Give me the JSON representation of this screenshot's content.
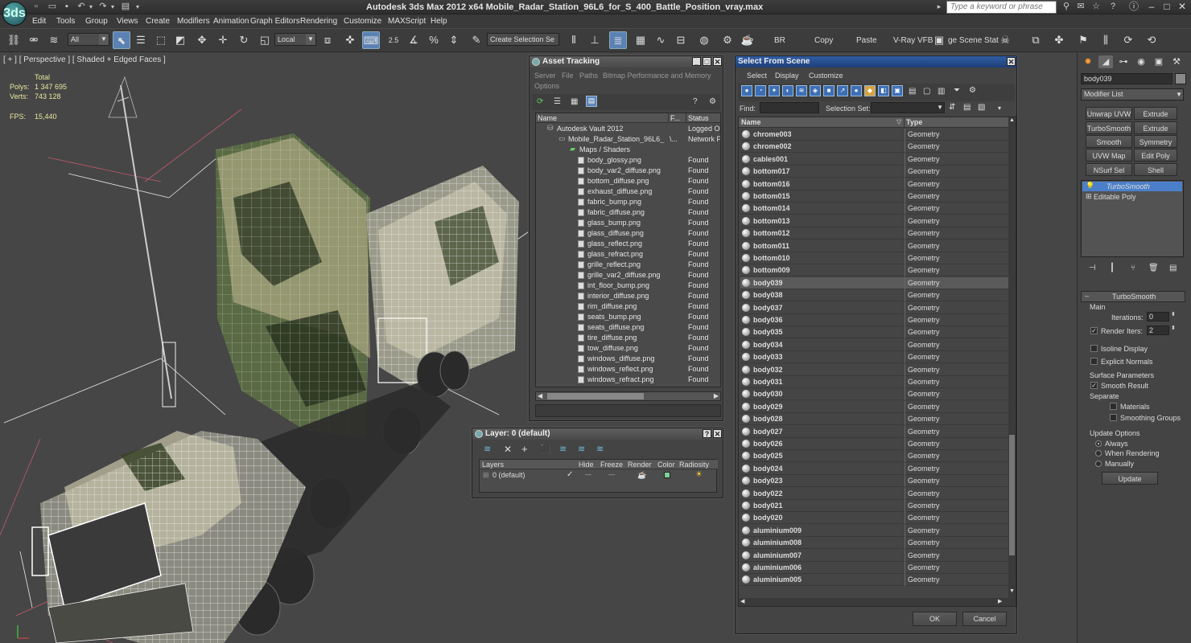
{
  "app": {
    "logo": "3ds",
    "title": "Autodesk 3ds Max  2012 x64      Mobile_Radar_Station_96L6_for_S_400_Battle_Position_vray.max",
    "search_placeholder": "Type a keyword or phrase",
    "quick_access_icons": [
      "new-file-icon",
      "open-file-icon",
      "save-icon",
      "undo-icon",
      "undo-dropdown-icon",
      "redo-icon",
      "redo-dropdown-icon",
      "project-folder-icon",
      "quick-access-dropdown-icon"
    ],
    "title_right_icons": [
      "binoculars-icon",
      "favorites-icon",
      "star-icon",
      "help-icon"
    ]
  },
  "menu": [
    "Edit",
    "Tools",
    "Group",
    "Views",
    "Create",
    "Modifiers",
    "Animation",
    "Graph Editors",
    "Rendering",
    "Customize",
    "MAXScript",
    "Help"
  ],
  "toolbar": {
    "selection_filter": "All",
    "reference_coord": "Local",
    "named_selection": "Create Selection Se",
    "snap_labels": [
      "2.5",
      "%"
    ],
    "text_buttons": [
      "BR",
      "Copy",
      "Paste",
      "V-Ray VFB",
      "ge Scene Stat"
    ]
  },
  "viewport": {
    "label": "[ + ] [ Perspective ] [ Shaded + Edged Faces ]",
    "stats": {
      "header": "Total",
      "polys_label": "Polys:",
      "polys_value": "1 347 695",
      "verts_label": "Verts:",
      "verts_value": "743 128",
      "fps_label": "FPS:",
      "fps_value": "15,440"
    }
  },
  "asset_tracking": {
    "title": "Asset Tracking",
    "menu": [
      "Server",
      "File",
      "Paths",
      "Bitmap Performance and Memory",
      "Options"
    ],
    "columns": [
      "Name",
      "F...",
      "Status"
    ],
    "rows": [
      {
        "name": "Autodesk Vault 2012",
        "f": "",
        "status": "Logged Out",
        "indent": 0
      },
      {
        "name": "Mobile_Radar_Station_96L6_...",
        "f": "\\...",
        "status": "Network Pa",
        "indent": 1
      },
      {
        "name": "Maps / Shaders",
        "f": "",
        "status": "",
        "indent": 2
      },
      {
        "name": "body_glossy.png",
        "f": "",
        "status": "Found",
        "indent": 3
      },
      {
        "name": "body_var2_diffuse.png",
        "f": "",
        "status": "Found",
        "indent": 3
      },
      {
        "name": "bottom_diffuse.png",
        "f": "",
        "status": "Found",
        "indent": 3
      },
      {
        "name": "exhaust_diffuse.png",
        "f": "",
        "status": "Found",
        "indent": 3
      },
      {
        "name": "fabric_bump.png",
        "f": "",
        "status": "Found",
        "indent": 3
      },
      {
        "name": "fabric_diffuse.png",
        "f": "",
        "status": "Found",
        "indent": 3
      },
      {
        "name": "glass_bump.png",
        "f": "",
        "status": "Found",
        "indent": 3
      },
      {
        "name": "glass_diffuse.png",
        "f": "",
        "status": "Found",
        "indent": 3
      },
      {
        "name": "glass_reflect.png",
        "f": "",
        "status": "Found",
        "indent": 3
      },
      {
        "name": "glass_refract.png",
        "f": "",
        "status": "Found",
        "indent": 3
      },
      {
        "name": "grille_reflect.png",
        "f": "",
        "status": "Found",
        "indent": 3
      },
      {
        "name": "grille_var2_diffuse.png",
        "f": "",
        "status": "Found",
        "indent": 3
      },
      {
        "name": "int_floor_bump.png",
        "f": "",
        "status": "Found",
        "indent": 3
      },
      {
        "name": "interior_diffuse.png",
        "f": "",
        "status": "Found",
        "indent": 3
      },
      {
        "name": "rim_diffuse.png",
        "f": "",
        "status": "Found",
        "indent": 3
      },
      {
        "name": "seats_bump.png",
        "f": "",
        "status": "Found",
        "indent": 3
      },
      {
        "name": "seats_diffuse.png",
        "f": "",
        "status": "Found",
        "indent": 3
      },
      {
        "name": "tire_diffuse.png",
        "f": "",
        "status": "Found",
        "indent": 3
      },
      {
        "name": "tow_diffuse.png",
        "f": "",
        "status": "Found",
        "indent": 3
      },
      {
        "name": "windows_diffuse.png",
        "f": "",
        "status": "Found",
        "indent": 3
      },
      {
        "name": "windows_reflect.png",
        "f": "",
        "status": "Found",
        "indent": 3
      },
      {
        "name": "windows_refract.png",
        "f": "",
        "status": "Found",
        "indent": 3
      }
    ]
  },
  "layer": {
    "title": "Layer: 0 (default)",
    "columns": [
      "Layers",
      "Hide",
      "Freeze",
      "Render",
      "Color",
      "Radiosity"
    ],
    "row_name": "0 (default)"
  },
  "select_from_scene": {
    "title": "Select From Scene",
    "menu": [
      "Select",
      "Display",
      "Customize"
    ],
    "find_label": "Find:",
    "selection_set_label": "Selection Set:",
    "columns": [
      "Name",
      "Type"
    ],
    "rows": [
      {
        "name": "chrome003",
        "type": "Geometry"
      },
      {
        "name": "chrome002",
        "type": "Geometry"
      },
      {
        "name": "cables001",
        "type": "Geometry"
      },
      {
        "name": "bottom017",
        "type": "Geometry"
      },
      {
        "name": "bottom016",
        "type": "Geometry"
      },
      {
        "name": "bottom015",
        "type": "Geometry"
      },
      {
        "name": "bottom014",
        "type": "Geometry"
      },
      {
        "name": "bottom013",
        "type": "Geometry"
      },
      {
        "name": "bottom012",
        "type": "Geometry"
      },
      {
        "name": "bottom011",
        "type": "Geometry"
      },
      {
        "name": "bottom010",
        "type": "Geometry"
      },
      {
        "name": "bottom009",
        "type": "Geometry"
      },
      {
        "name": "body039",
        "type": "Geometry",
        "selected": true
      },
      {
        "name": "body038",
        "type": "Geometry"
      },
      {
        "name": "body037",
        "type": "Geometry"
      },
      {
        "name": "body036",
        "type": "Geometry"
      },
      {
        "name": "body035",
        "type": "Geometry"
      },
      {
        "name": "body034",
        "type": "Geometry"
      },
      {
        "name": "body033",
        "type": "Geometry"
      },
      {
        "name": "body032",
        "type": "Geometry"
      },
      {
        "name": "body031",
        "type": "Geometry"
      },
      {
        "name": "body030",
        "type": "Geometry"
      },
      {
        "name": "body029",
        "type": "Geometry"
      },
      {
        "name": "body028",
        "type": "Geometry"
      },
      {
        "name": "body027",
        "type": "Geometry"
      },
      {
        "name": "body026",
        "type": "Geometry"
      },
      {
        "name": "body025",
        "type": "Geometry"
      },
      {
        "name": "body024",
        "type": "Geometry"
      },
      {
        "name": "body023",
        "type": "Geometry"
      },
      {
        "name": "body022",
        "type": "Geometry"
      },
      {
        "name": "body021",
        "type": "Geometry"
      },
      {
        "name": "body020",
        "type": "Geometry"
      },
      {
        "name": "aluminium009",
        "type": "Geometry"
      },
      {
        "name": "aluminium008",
        "type": "Geometry"
      },
      {
        "name": "aluminium007",
        "type": "Geometry"
      },
      {
        "name": "aluminium006",
        "type": "Geometry"
      },
      {
        "name": "aluminium005",
        "type": "Geometry"
      }
    ],
    "ok_label": "OK",
    "cancel_label": "Cancel"
  },
  "command_panel": {
    "object_name": "body039",
    "modifier_list": "Modifier List",
    "modifier_buttons": [
      "Unwrap UVW",
      "Extrude",
      "TurboSmooth",
      "Extrude",
      "Smooth",
      "Symmetry",
      "UVW Map",
      "Edit Poly",
      "NSurf Sel",
      "Shell"
    ],
    "stack": [
      "TurboSmooth",
      "Editable Poly"
    ],
    "rollout_title": "TurboSmooth",
    "main_label": "Main",
    "iterations_label": "Iterations:",
    "iterations_value": "0",
    "render_iters_label": "Render Iters:",
    "render_iters_value": "2",
    "isoline_label": "Isoline Display",
    "explicit_normals_label": "Explicit Normals",
    "surface_params_label": "Surface Parameters",
    "smooth_result_label": "Smooth Result",
    "separate_label": "Separate",
    "materials_label": "Materials",
    "smoothing_groups_label": "Smoothing Groups",
    "update_options_label": "Update Options",
    "always_label": "Always",
    "when_rendering_label": "When Rendering",
    "manually_label": "Manually",
    "update_button": "Update"
  }
}
